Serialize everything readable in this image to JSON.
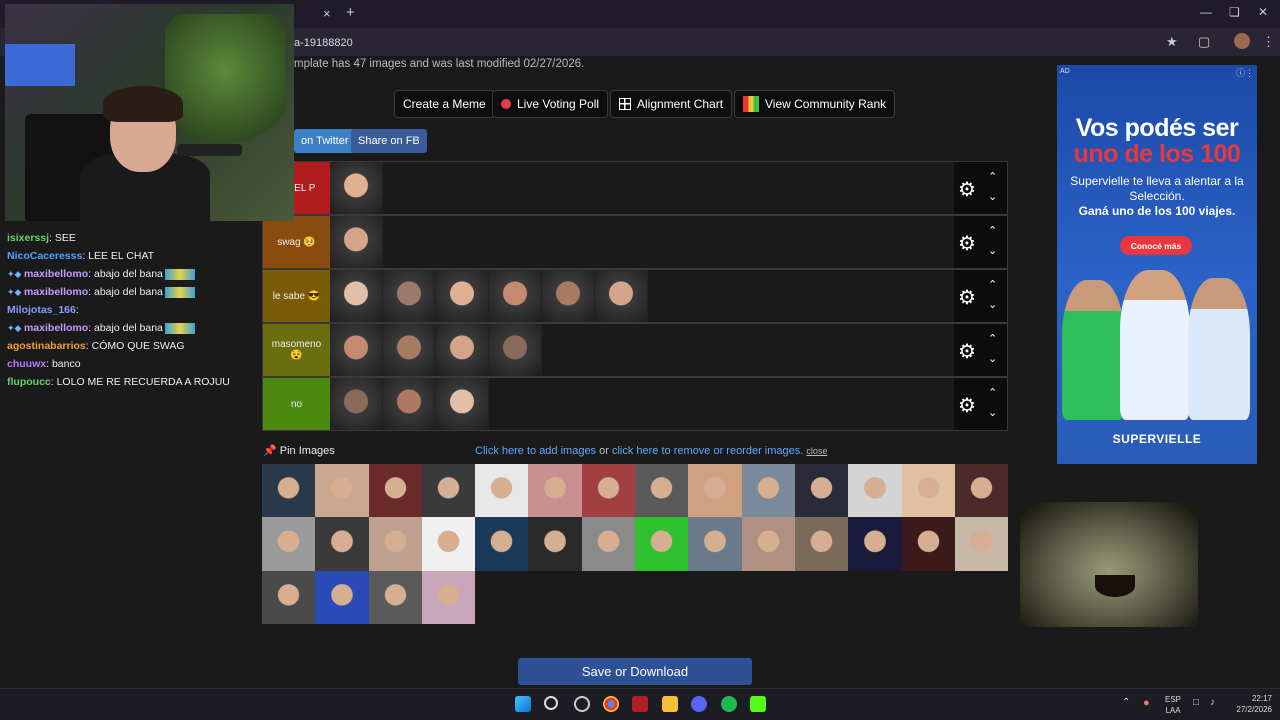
{
  "browser": {
    "url": "a-19188820",
    "tab_close": "×",
    "new_tab": "+"
  },
  "page": {
    "subtitle": "mplate has 47 images and was last modified 02/27/2026.",
    "buttons": {
      "create": "Create a Meme",
      "poll": "Live Voting Poll",
      "alignment": "Alignment Chart",
      "rank": "View Community Rank"
    },
    "share_twitter": "on Twitter",
    "share_fb": "Share on FB"
  },
  "tiers": [
    {
      "label": "S DEL P",
      "color": "#b11d1d",
      "images": 1
    },
    {
      "label": "swag 🥺",
      "color": "#8a4b0e",
      "images": 1
    },
    {
      "label": "le sabe 😎",
      "color": "#7a5b08",
      "images": 6
    },
    {
      "label": "masomeno 😵",
      "color": "#6b6e0f",
      "images": 4
    },
    {
      "label": "no",
      "color": "#4b8a0f",
      "images": 3
    }
  ],
  "pin": {
    "title": "Pin Images",
    "add_link": "Click here to add images",
    "or": " or ",
    "remove_link": "click here to remove or reorder images.",
    "close": "close"
  },
  "save_button": "Save or Download",
  "ad": {
    "tag": "AD",
    "headline_1": "Vos podés ser",
    "headline_2": "uno de los 100",
    "body": "Supervielle te lleva a alentar a la Selección.",
    "body_bold": "Ganá uno de los 100 viajes.",
    "cta": "Conocé más",
    "brand": "SUPERVIELLE"
  },
  "chat": [
    {
      "user": "isixerssj",
      "color": "#66d36e",
      "text": "SEE"
    },
    {
      "user": "NicoCaceresss",
      "color": "#4aa3ff",
      "text": "LEE EL CHAT"
    },
    {
      "user": "maxibellomo",
      "color": "#c59cff",
      "text": "abajo del bana",
      "badge": true
    },
    {
      "user": "maxibellomo",
      "color": "#c59cff",
      "text": "abajo del bana",
      "badge": true
    },
    {
      "user": "Milojotas_166",
      "color": "#8a9cff",
      "text": ""
    },
    {
      "user": "maxibellomo",
      "color": "#c59cff",
      "text": "abajo del bana",
      "badge": true
    },
    {
      "user": "agostinabarrios",
      "color": "#f0a030",
      "text": "CÓMO QUE SWAG"
    },
    {
      "user": "chuuwx",
      "color": "#b57cff",
      "text": "banco"
    },
    {
      "user": "flupoucc",
      "color": "#66d36e",
      "text": "LOLO ME RE RECUERDA A ROJUU"
    }
  ],
  "taskbar": {
    "lang_top": "ESP",
    "lang_bottom": "LAA",
    "time": "22:17",
    "date": "27/2/2026"
  },
  "colors": {
    "accent_blue": "#2e5195",
    "ad_bg": "#2b63c8"
  }
}
